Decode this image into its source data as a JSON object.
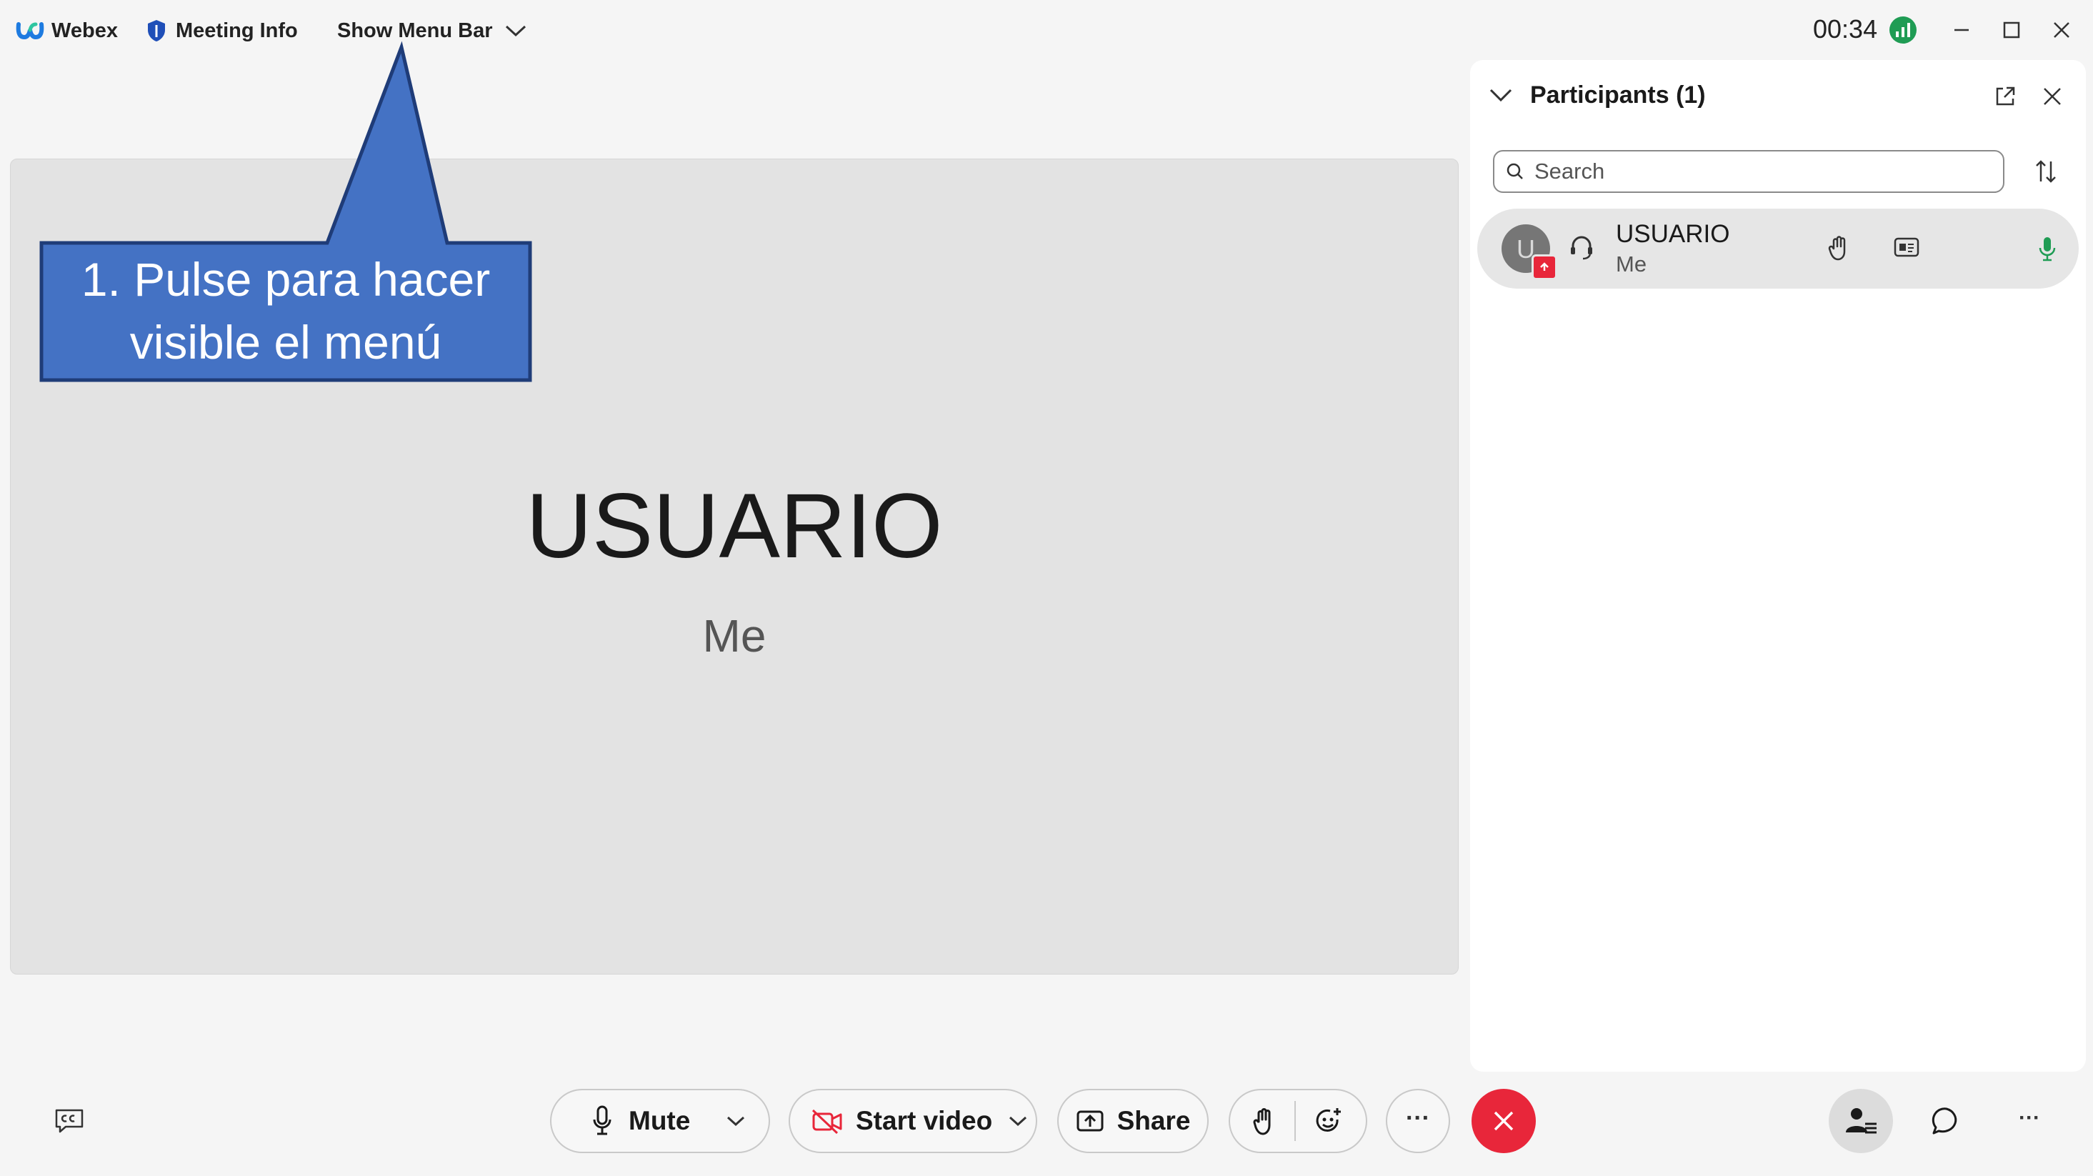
{
  "titlebar": {
    "app_name": "Webex",
    "meeting_info": "Meeting Info",
    "show_menu_bar": "Show Menu Bar",
    "timer": "00:34"
  },
  "callout": {
    "line1": "1. Pulse para hacer",
    "line2": "visible el menú",
    "color": "#4472c4"
  },
  "stage": {
    "name": "USUARIO",
    "subtitle": "Me"
  },
  "participants_panel": {
    "title": "Participants (1)",
    "search_placeholder": "Search",
    "participants": [
      {
        "name": "USUARIO",
        "subtitle": "Me",
        "avatar_initial": "U"
      }
    ]
  },
  "controls": {
    "mute_label": "Mute",
    "start_video_label": "Start video",
    "share_label": "Share",
    "more_label": "···",
    "end_color": "#e8263a"
  },
  "icons": [
    "webex-logo-icon",
    "shield-icon",
    "chevron-down-icon",
    "signal-icon",
    "minimize-icon",
    "maximize-icon",
    "close-icon",
    "popout-icon",
    "search-icon",
    "sort-icon",
    "headset-icon",
    "raise-hand-icon",
    "caption-card-icon",
    "microphone-icon",
    "captions-icon",
    "video-off-icon",
    "share-icon",
    "reaction-icon",
    "end-call-icon",
    "participants-icon",
    "chat-icon"
  ]
}
